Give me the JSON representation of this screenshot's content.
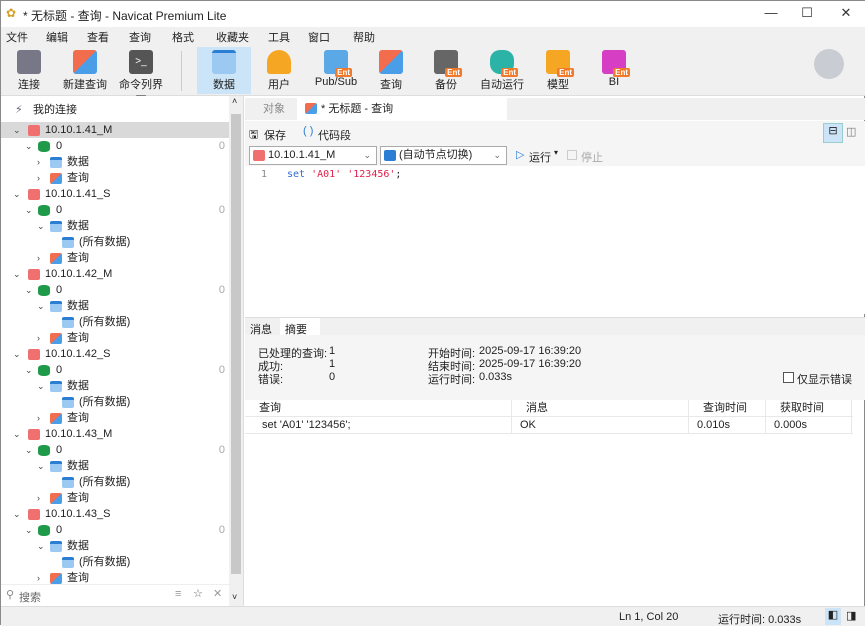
{
  "window": {
    "title": "* 无标题 - 查询 - Navicat Premium Lite"
  },
  "menu": [
    "文件",
    "编辑",
    "查看",
    "查询",
    "格式",
    "收藏夹",
    "工具",
    "窗口",
    "帮助"
  ],
  "toolbar": [
    {
      "label": "连接"
    },
    {
      "label": "新建查询"
    },
    {
      "label": "命令列界面"
    },
    {
      "label": "数据"
    },
    {
      "label": "用户"
    },
    {
      "label": "Pub/Sub"
    },
    {
      "label": "查询"
    },
    {
      "label": "备份"
    },
    {
      "label": "自动运行"
    },
    {
      "label": "模型"
    },
    {
      "label": "BI"
    }
  ],
  "ent_badge": "Ent",
  "sidebar": {
    "root": "我的连接",
    "search_placeholder": "搜索",
    "connections": [
      {
        "name": "10.10.1.41_M",
        "db": "0",
        "count": "0",
        "data": "数据",
        "all": null,
        "query": "查询"
      },
      {
        "name": "10.10.1.41_S",
        "db": "0",
        "count": "0",
        "data": "数据",
        "all": "(所有数据)",
        "query": "查询"
      },
      {
        "name": "10.10.1.42_M",
        "db": "0",
        "count": "0",
        "data": "数据",
        "all": "(所有数据)",
        "query": "查询"
      },
      {
        "name": "10.10.1.42_S",
        "db": "0",
        "count": "0",
        "data": "数据",
        "all": "(所有数据)",
        "query": "查询"
      },
      {
        "name": "10.10.1.43_M",
        "db": "0",
        "count": "0",
        "data": "数据",
        "all": "(所有数据)",
        "query": "查询"
      },
      {
        "name": "10.10.1.43_S",
        "db": "0",
        "count": "0",
        "data": "数据",
        "all": "(所有数据)",
        "query": "查询"
      }
    ]
  },
  "tabs": {
    "objects": "对象",
    "query": "* 无标题 - 查询"
  },
  "query_toolbar": {
    "save": "保存",
    "snippet": "代码段",
    "connection": "10.10.1.41_M",
    "node": "(自动节点切换)",
    "run": "运行",
    "stop": "停止"
  },
  "editor": {
    "line": "1",
    "kw": "set",
    "s1": "'A01'",
    "s2": "'123456'",
    "end": ";"
  },
  "results": {
    "tab_msg": "消息",
    "tab_summary": "摘要",
    "summary": {
      "processed_label": "已处理的查询:",
      "processed": "1",
      "success_label": "成功:",
      "success": "1",
      "error_label": "错误:",
      "error": "0",
      "start_label": "开始时间:",
      "start": "2025-09-17 16:39:20",
      "end_label": "结束时间:",
      "end": "2025-09-17 16:39:20",
      "elapsed_label": "运行时间:",
      "elapsed": "0.033s",
      "only_errors": "仅显示错误"
    },
    "columns": [
      "查询",
      "消息",
      "查询时间",
      "获取时间"
    ],
    "rows": [
      [
        "set 'A01' '123456';",
        "OK",
        "0.010s",
        "0.000s"
      ]
    ]
  },
  "status": {
    "pos": "Ln 1, Col 20",
    "elapsed": "运行时间: 0.033s"
  }
}
